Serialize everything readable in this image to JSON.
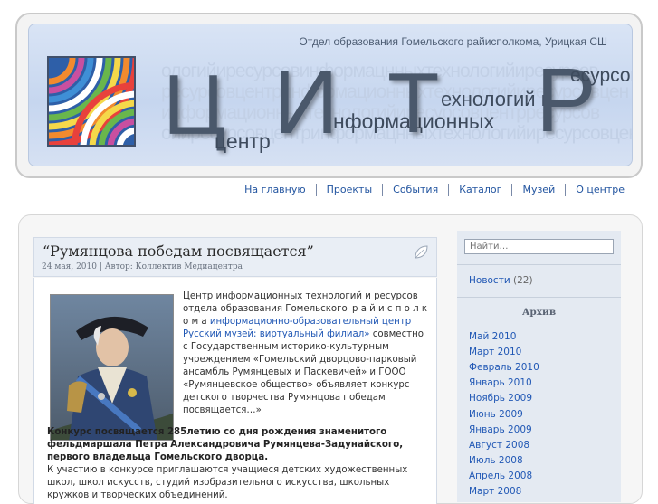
{
  "header": {
    "tagline": "Отдел образования Гомельского райисполкома, Урицкая СШ",
    "logo_letters": {
      "c": "Ц",
      "i": "И",
      "t": "Т",
      "r": "Р"
    },
    "logo_words": {
      "center": "центр",
      "informational": "нформационных",
      "technologies": "ехнологий и",
      "resources": "есурсов"
    },
    "bg_words": [
      "ологийиресурсовинформацнныхтехнологийиресурсов",
      "ресурсовцентринформационныхтехнологийиресурсовцен",
      "информационныхтехнологийиресурсовцентрресурсов",
      "ойиресурсовцентринформацнныхтехнологийиресурсовцентринфо"
    ]
  },
  "nav": {
    "items": [
      "На главную",
      "Проекты",
      "События",
      "Каталог",
      "Музей",
      "О центре"
    ]
  },
  "post": {
    "title": "“Румянцова победам посвящается”",
    "meta": "24 мая, 2010 | Автор: Коллектив Медиацентра",
    "para1_a": "Центр информационных технологий и ресурсов отдела образования Гомельского",
    "para1_b": "р а й и с п о л к о м а",
    "para1_link": "информационно-образовательный центр  Русский музей: виртуальный филиал»",
    "para1_c": "совместно с Государственным историко-культурным учреждением «Гомельский дворцово-парковый ансамбль Румянцевых и Паскевичей» и ГООО «Румянцевское общество» объявляет конкурс детского творчества   Румянцова победам посвящается…»",
    "bold_text": "Конкурс посвящается   285летию со дня рождения знаменитого фельдмаршала Петра Александровича Румянцева-Задунайского, первого владельца Гомельского дворца.",
    "para2": "К участию в конкурсе приглашаются учащиеся детских художественных школ, школ искусств, студий изобразительного искусства, школьных кружков и творческих объединений."
  },
  "sidebar": {
    "search_placeholder": "Найти…",
    "category": {
      "label": "Новости",
      "count": "(22)"
    },
    "archive_title": "Архив",
    "archive": [
      "Май 2010",
      "Март 2010",
      "Февраль 2010",
      "Январь 2010",
      "Ноябрь 2009",
      "Июнь 2009",
      "Январь 2009",
      "Август 2008",
      "Июль 2008",
      "Апрель 2008",
      "Март 2008"
    ]
  },
  "colors": {
    "link": "#2158b5",
    "banner": "#c6d6ef",
    "logo_text": "#4a586b"
  }
}
